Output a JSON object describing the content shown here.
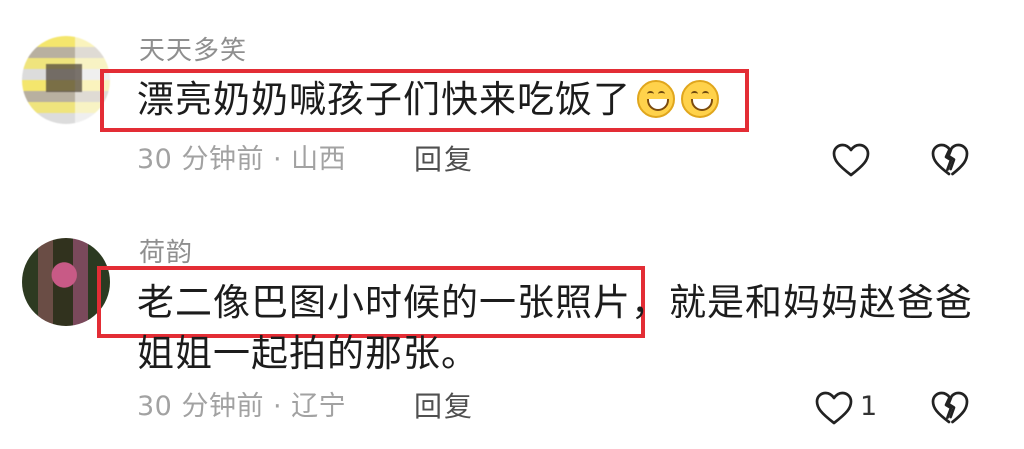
{
  "comments": [
    {
      "username": "天天多笑",
      "text_lines": [
        "漂亮奶奶喊孩子们快来吃饭了"
      ],
      "emojis": [
        "grinning-face-icon",
        "grinning-face-icon"
      ],
      "time_location": "30 分钟前 · 山西",
      "reply_label": "回复",
      "like_count": ""
    },
    {
      "username": "荷韵",
      "text_lines": [
        "老二像巴图小时候的一张照片，就是和妈妈赵爸爸",
        "姐姐一起拍的那张。"
      ],
      "time_location": "30 分钟前 · 辽宁",
      "reply_label": "回复",
      "like_count": "1"
    }
  ],
  "colors": {
    "highlight": "#e32d35",
    "meta": "#a2a2a2",
    "text": "#1c1c1c"
  }
}
